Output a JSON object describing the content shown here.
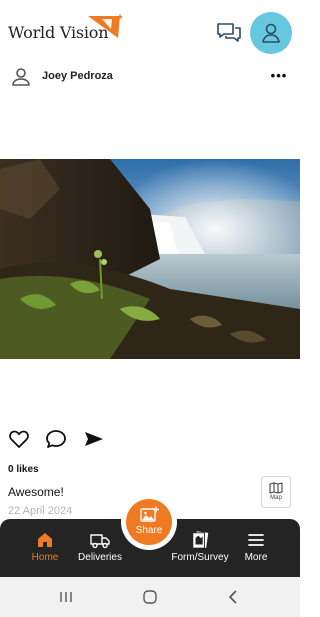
{
  "app": {
    "logo_text": "World Vision",
    "brand_color": "#f07a22",
    "avatar_color": "#66c7df"
  },
  "header": {
    "chat_icon": "chat-bubbles-icon",
    "profile_icon": "person-icon"
  },
  "post": {
    "author": "Joey Pedroza",
    "menu_icon": "more-horizontal-icon",
    "image_subject": "waterfall-landscape",
    "likes": "0 likes",
    "caption": "Awesome!",
    "date": "22 April 2024",
    "actions": [
      "heart-icon",
      "comment-icon",
      "send-icon"
    ],
    "map_label": "Map"
  },
  "bottom_nav": {
    "items": [
      {
        "label": "Home",
        "icon": "home-icon",
        "active": true
      },
      {
        "label": "Deliveries",
        "icon": "truck-icon",
        "active": false
      },
      {
        "label": "Form/Survey",
        "icon": "form-icon",
        "active": false
      },
      {
        "label": "More",
        "icon": "menu-icon",
        "active": false
      }
    ],
    "share_label": "Share"
  },
  "system_nav": [
    "recents-icon",
    "home-circle-icon",
    "back-icon"
  ]
}
